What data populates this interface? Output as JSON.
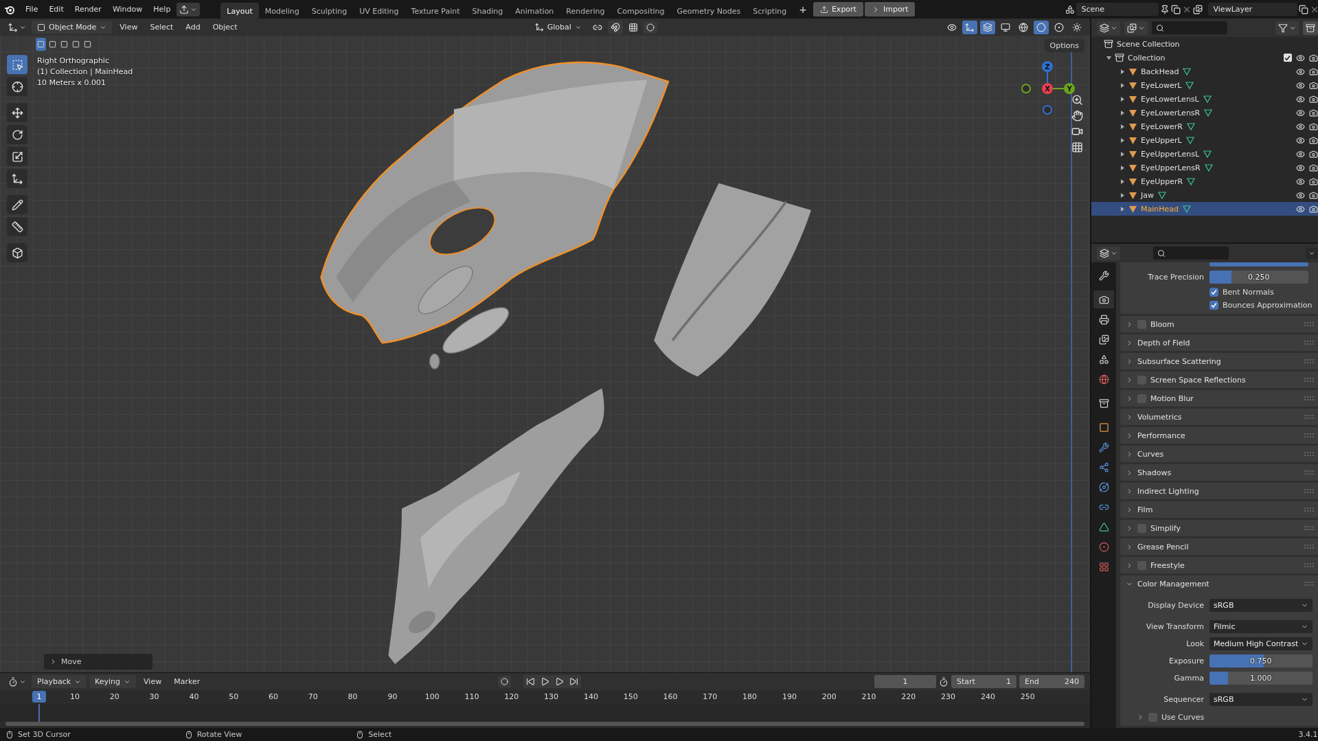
{
  "top_bar": {
    "menus": [
      "File",
      "Edit",
      "Render",
      "Window",
      "Help"
    ],
    "workspaces": [
      {
        "label": "Layout",
        "selected": true
      },
      {
        "label": "Modeling",
        "selected": false
      },
      {
        "label": "Sculpting",
        "selected": false
      },
      {
        "label": "UV Editing",
        "selected": false
      },
      {
        "label": "Texture Paint",
        "selected": false
      },
      {
        "label": "Shading",
        "selected": false
      },
      {
        "label": "Animation",
        "selected": false
      },
      {
        "label": "Rendering",
        "selected": false
      },
      {
        "label": "Compositing",
        "selected": false
      },
      {
        "label": "Geometry Nodes",
        "selected": false
      },
      {
        "label": "Scripting",
        "selected": false
      }
    ],
    "add_workspace": "+",
    "actions": [
      "Export",
      "Import"
    ],
    "scene": "Scene",
    "view_layer": "ViewLayer"
  },
  "viewport": {
    "mode": "Object Mode",
    "menus": [
      "View",
      "Select",
      "Add",
      "Object"
    ],
    "orientation": "Global",
    "options": "Options",
    "toolbar": [
      {
        "selected": true
      },
      {
        "selected": false
      },
      {
        "selected": false
      },
      {
        "selected": false
      },
      {
        "selected": false
      },
      {
        "selected": false
      },
      {
        "selected": false
      },
      {
        "selected": false
      },
      {
        "selected": false
      }
    ],
    "info": [
      "Right Orthographic",
      "(1) Collection | MainHead",
      "10 Meters x 0.001"
    ],
    "gizmo": [
      {
        "label": "Z",
        "color": "#2f6fd1"
      },
      {
        "label": "X",
        "color": "#e8404f"
      },
      {
        "label": "Y",
        "color": "#6ba51e"
      }
    ],
    "last_operator": "Move"
  },
  "outliner": {
    "root": "Scene Collection",
    "collections": [
      {
        "name": "Collection",
        "expanded": true,
        "checked": true,
        "children": [
          {
            "name": "BackHead",
            "selected": false
          },
          {
            "name": "EyeLowerL",
            "selected": false
          },
          {
            "name": "EyeLowerLensL",
            "selected": false
          },
          {
            "name": "EyeLowerLensR",
            "selected": false
          },
          {
            "name": "EyeLowerR",
            "selected": false
          },
          {
            "name": "EyeUpperL",
            "selected": false
          },
          {
            "name": "EyeUpperLensL",
            "selected": false
          },
          {
            "name": "EyeUpperLensR",
            "selected": false
          },
          {
            "name": "EyeUpperR",
            "selected": false
          },
          {
            "name": "Jaw",
            "selected": false
          },
          {
            "name": "MainHead",
            "selected": true
          }
        ]
      }
    ]
  },
  "properties": {
    "tabs": [
      {
        "selected": false
      },
      {
        "selected": true
      },
      {
        "selected": false
      },
      {
        "selected": false
      },
      {
        "selected": false
      },
      {
        "selected": false
      },
      {
        "selected": false
      },
      {
        "selected": false
      },
      {
        "selected": false
      },
      {
        "selected": false
      },
      {
        "selected": false
      },
      {
        "selected": false
      },
      {
        "selected": false
      },
      {
        "selected": false
      },
      {
        "selected": false
      }
    ],
    "cut_slider": {
      "level": 1
    },
    "trace_precision": {
      "label": "Trace Precision",
      "value": "0.250",
      "level": 0.22
    },
    "options": [
      {
        "label": "Bent Normals",
        "checked": true
      },
      {
        "label": "Bounces Approximation",
        "checked": true
      }
    ],
    "panels": [
      {
        "label": "Bloom",
        "kind": "toggle",
        "checked": false,
        "expanded": false
      },
      {
        "label": "Depth of Field",
        "kind": "plain",
        "expanded": false
      },
      {
        "label": "Subsurface Scattering",
        "kind": "plain",
        "expanded": false
      },
      {
        "label": "Screen Space Reflections",
        "kind": "toggle",
        "checked": false,
        "expanded": false
      },
      {
        "label": "Motion Blur",
        "kind": "toggle",
        "checked": false,
        "expanded": false
      },
      {
        "label": "Volumetrics",
        "kind": "plain",
        "expanded": false
      },
      {
        "label": "Performance",
        "kind": "plain",
        "expanded": false
      },
      {
        "label": "Curves",
        "kind": "plain",
        "expanded": false
      },
      {
        "label": "Shadows",
        "kind": "plain",
        "expanded": false
      },
      {
        "label": "Indirect Lighting",
        "kind": "plain",
        "expanded": false
      },
      {
        "label": "Film",
        "kind": "plain",
        "expanded": false
      },
      {
        "label": "Simplify",
        "kind": "toggle",
        "checked": false,
        "expanded": false
      },
      {
        "label": "Grease Pencil",
        "kind": "plain",
        "expanded": false
      },
      {
        "label": "Freestyle",
        "kind": "toggle",
        "checked": false,
        "expanded": false
      }
    ],
    "color_management": {
      "label": "Color Management",
      "expanded": true,
      "fields": [
        {
          "kind": "dropdown",
          "label": "Display Device",
          "value": "sRGB"
        },
        {
          "kind": "dropdown",
          "label": "View Transform",
          "value": "Filmic"
        },
        {
          "kind": "dropdown",
          "label": "Look",
          "value": "Medium High Contrast"
        },
        {
          "kind": "slider",
          "label": "Exposure",
          "value": "0.750",
          "level": 0.53
        },
        {
          "kind": "slider",
          "label": "Gamma",
          "value": "1.000",
          "level": 0.18
        },
        {
          "kind": "dropdown",
          "label": "Sequencer",
          "value": "sRGB"
        }
      ],
      "subpanel": {
        "label": "Use Curves",
        "checked": false,
        "expanded": false
      }
    }
  },
  "timeline": {
    "menus": [
      "Playback",
      "Keying",
      "View",
      "Marker"
    ],
    "current_frame": "1",
    "start_label": "Start",
    "start": "1",
    "end_label": "End",
    "end": "240",
    "playhead": "1",
    "ticks": [
      "10",
      "20",
      "30",
      "40",
      "50",
      "60",
      "70",
      "80",
      "90",
      "100",
      "110",
      "120",
      "130",
      "140",
      "150",
      "160",
      "170",
      "180",
      "190",
      "200",
      "210",
      "220",
      "230",
      "240",
      "250"
    ]
  },
  "status_bar": {
    "hints": [
      "Set 3D Cursor",
      "Rotate View",
      "Select"
    ],
    "version": "3.4.1"
  }
}
